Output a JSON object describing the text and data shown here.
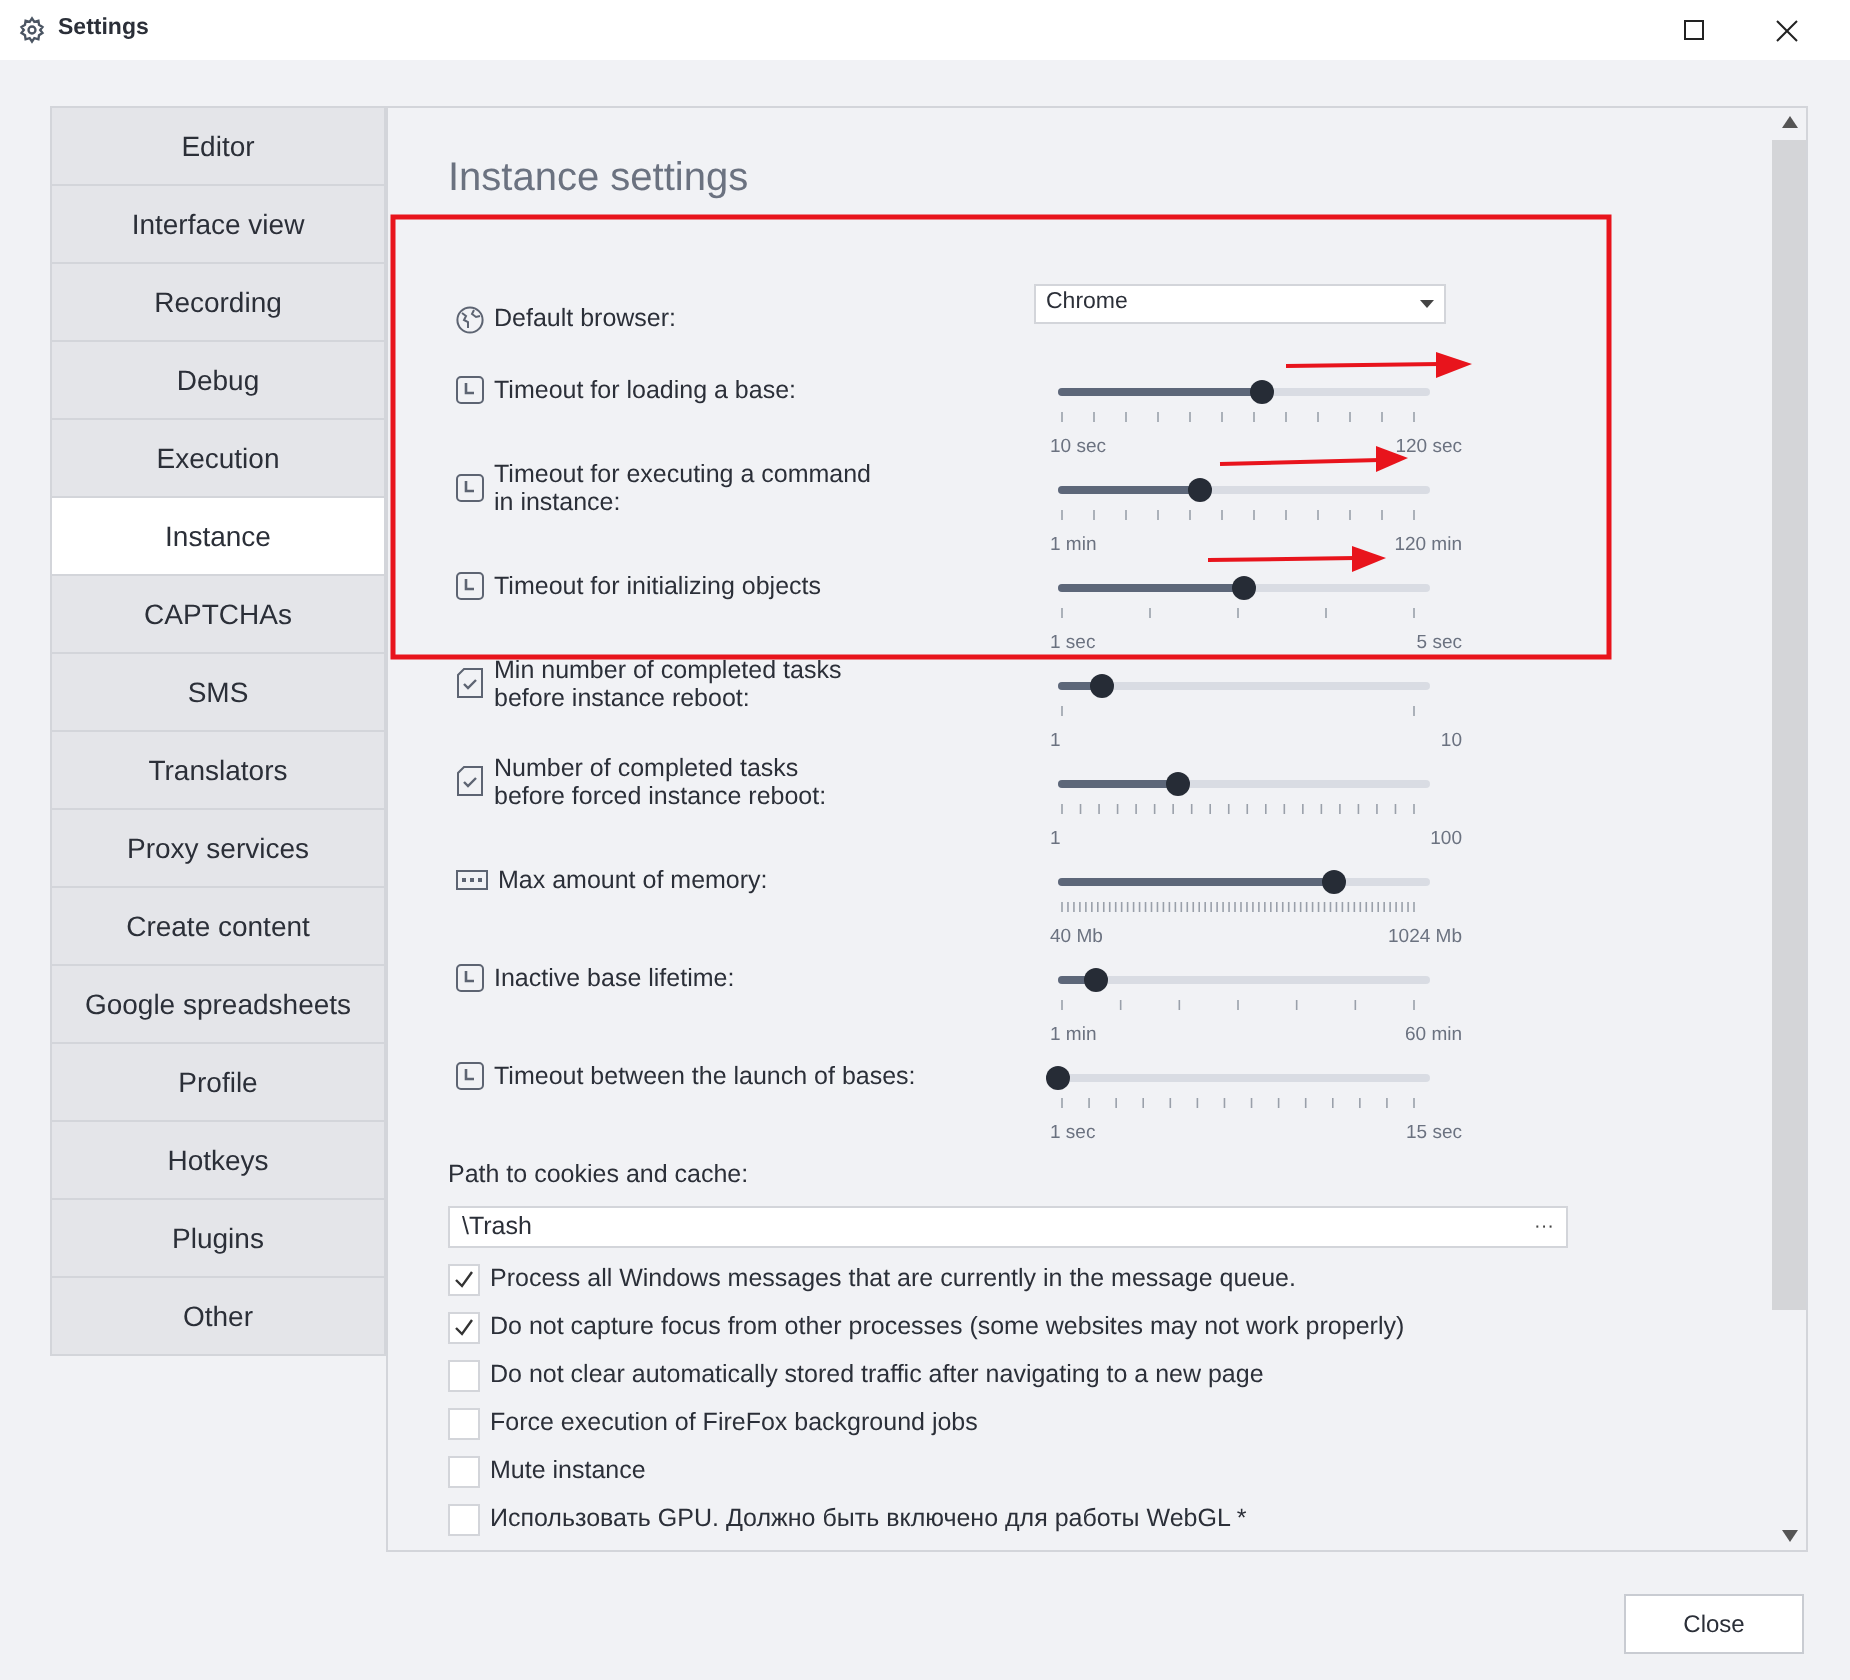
{
  "window": {
    "title": "Settings"
  },
  "sidebar": {
    "items": [
      {
        "label": "Editor",
        "selected": false
      },
      {
        "label": "Interface view",
        "selected": false
      },
      {
        "label": "Recording",
        "selected": false
      },
      {
        "label": "Debug",
        "selected": false
      },
      {
        "label": "Execution",
        "selected": false
      },
      {
        "label": "Instance",
        "selected": true
      },
      {
        "label": "CAPTCHAs",
        "selected": false
      },
      {
        "label": "SMS",
        "selected": false
      },
      {
        "label": "Translators",
        "selected": false
      },
      {
        "label": "Proxy services",
        "selected": false
      },
      {
        "label": "Create content",
        "selected": false
      },
      {
        "label": "Google spreadsheets",
        "selected": false
      },
      {
        "label": "Profile",
        "selected": false
      },
      {
        "label": "Hotkeys",
        "selected": false
      },
      {
        "label": "Plugins",
        "selected": false
      },
      {
        "label": "Other",
        "selected": false
      }
    ]
  },
  "panel": {
    "title": "Instance settings",
    "default_browser": {
      "label": "Default browser:",
      "value": "Chrome"
    },
    "sliders": [
      {
        "kind": "clock",
        "label": "Timeout for loading a base:",
        "level": 0.55,
        "min": "10 sec",
        "max": "120 sec"
      },
      {
        "kind": "clock",
        "label": "Timeout for executing a command\nin instance:",
        "level": 0.38,
        "min": "1 min",
        "max": "120 min"
      },
      {
        "kind": "clock",
        "label": "Timeout for initializing objects",
        "level": 0.5,
        "min": "1 sec",
        "max": "5 sec"
      },
      {
        "kind": "tasks",
        "label": "Min number of completed tasks\nbefore instance reboot:",
        "level": 0.12,
        "min": "1",
        "max": "10"
      },
      {
        "kind": "tasks",
        "label": "Number of completed tasks\nbefore forced instance reboot:",
        "level": 0.32,
        "min": "1",
        "max": "100"
      },
      {
        "kind": "memory",
        "label": "Max amount of memory:",
        "level": 0.74,
        "min": "40 Mb",
        "max": "1024 Mb"
      },
      {
        "kind": "clock",
        "label": "Inactive base lifetime:",
        "level": 0.1,
        "min": "1 min",
        "max": "60 min"
      },
      {
        "kind": "clock",
        "label": "Timeout between the launch of bases:",
        "level": 0,
        "min": "1 sec",
        "max": "15 sec"
      }
    ],
    "path": {
      "label": "Path to cookies and cache:",
      "value": "\\Trash",
      "button": "···"
    },
    "checkboxes": [
      {
        "label": "Process all Windows messages that are currently in the message queue.",
        "checked": true
      },
      {
        "label": "Do not capture focus from other processes (some websites may not work properly)",
        "checked": true
      },
      {
        "label": "Do not clear automatically stored traffic after navigating to a new page",
        "checked": false
      },
      {
        "label": "Force execution of FireFox background jobs",
        "checked": false
      },
      {
        "label": "Mute instance",
        "checked": false
      },
      {
        "label": "Использовать GPU. Должно быть включено для работы WebGL *",
        "checked": false
      }
    ]
  },
  "buttons": {
    "close": "Close"
  }
}
